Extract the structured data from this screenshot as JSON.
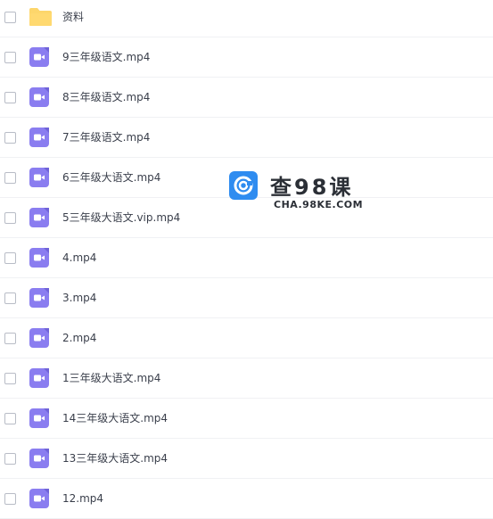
{
  "files": [
    {
      "name": "资料",
      "type": "folder"
    },
    {
      "name": "9三年级语文.mp4",
      "type": "video"
    },
    {
      "name": "8三年级语文.mp4",
      "type": "video"
    },
    {
      "name": "7三年级语文.mp4",
      "type": "video"
    },
    {
      "name": "6三年级大语文.mp4",
      "type": "video"
    },
    {
      "name": "5三年级大语文.vip.mp4",
      "type": "video"
    },
    {
      "name": "4.mp4",
      "type": "video"
    },
    {
      "name": "3.mp4",
      "type": "video"
    },
    {
      "name": "2.mp4",
      "type": "video"
    },
    {
      "name": "1三年级大语文.mp4",
      "type": "video"
    },
    {
      "name": "14三年级大语文.mp4",
      "type": "video"
    },
    {
      "name": "13三年级大语文.mp4",
      "type": "video"
    },
    {
      "name": "12.mp4",
      "type": "video"
    }
  ],
  "watermark": {
    "title": "查98课",
    "subtitle": "CHA.98KE.COM"
  },
  "colors": {
    "folder": "#fdd66b",
    "video": "#8a7df0",
    "watermark_logo": "#2f8cf0"
  }
}
